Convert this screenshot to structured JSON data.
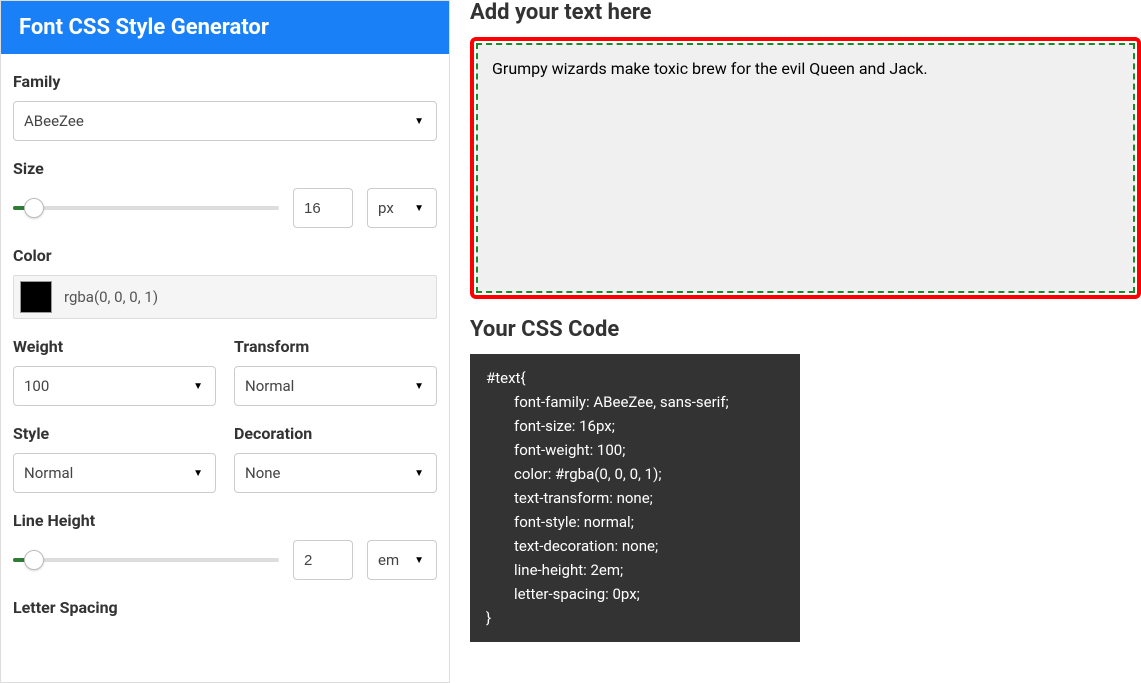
{
  "panel": {
    "title": "Font CSS Style Generator",
    "family": {
      "label": "Family",
      "value": "ABeeZee"
    },
    "size": {
      "label": "Size",
      "value": "16",
      "unit": "px"
    },
    "color": {
      "label": "Color",
      "value": "rgba(0, 0, 0, 1)"
    },
    "weight": {
      "label": "Weight",
      "value": "100"
    },
    "transform": {
      "label": "Transform",
      "value": "Normal"
    },
    "style": {
      "label": "Style",
      "value": "Normal"
    },
    "decoration": {
      "label": "Decoration",
      "value": "None"
    },
    "lineHeight": {
      "label": "Line Height",
      "value": "2",
      "unit": "em"
    },
    "letterSpacing": {
      "label": "Letter Spacing"
    }
  },
  "preview": {
    "title": "Add your text here",
    "text": "Grumpy wizards make toxic brew for the evil Queen and Jack."
  },
  "css": {
    "title": "Your CSS Code",
    "selector": "#text{",
    "lines": [
      "font-family: ABeeZee, sans-serif;",
      "font-size: 16px;",
      "font-weight: 100;",
      "color: #rgba(0, 0, 0, 1);",
      "text-transform: none;",
      "font-style: normal;",
      "text-decoration: none;",
      "line-height: 2em;",
      "letter-spacing: 0px;"
    ],
    "close": "}"
  }
}
